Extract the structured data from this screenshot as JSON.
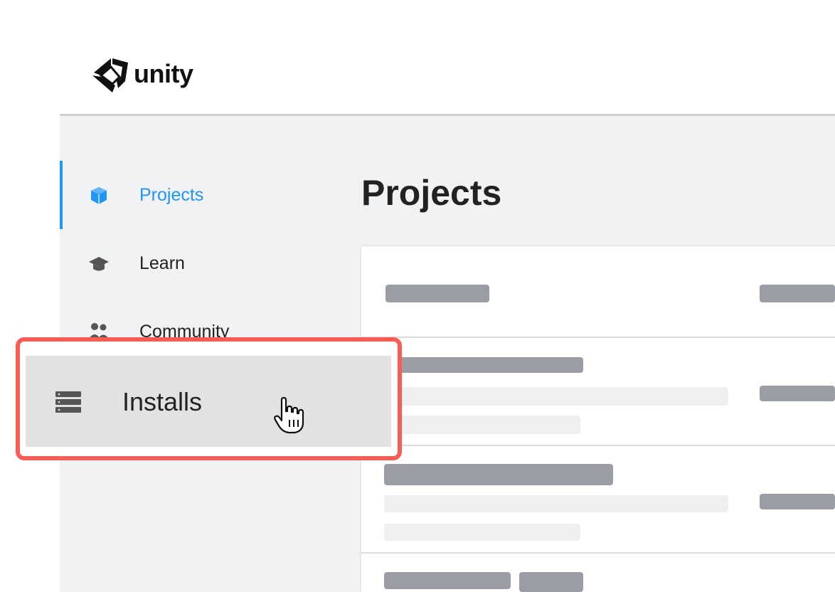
{
  "brand": {
    "name": "unity"
  },
  "sidebar": {
    "items": [
      {
        "label": "Projects",
        "icon": "cube-icon",
        "active": true
      },
      {
        "label": "Learn",
        "icon": "graduation-cap-icon",
        "active": false
      },
      {
        "label": "Community",
        "icon": "people-icon",
        "active": false
      },
      {
        "label": "Installs",
        "icon": "server-list-icon",
        "active": false,
        "highlighted": true
      }
    ]
  },
  "main": {
    "title": "Projects"
  },
  "colors": {
    "accent": "#2196f3",
    "highlight_border": "#fa5c53",
    "sidebar_bg": "#f1f2f4"
  }
}
